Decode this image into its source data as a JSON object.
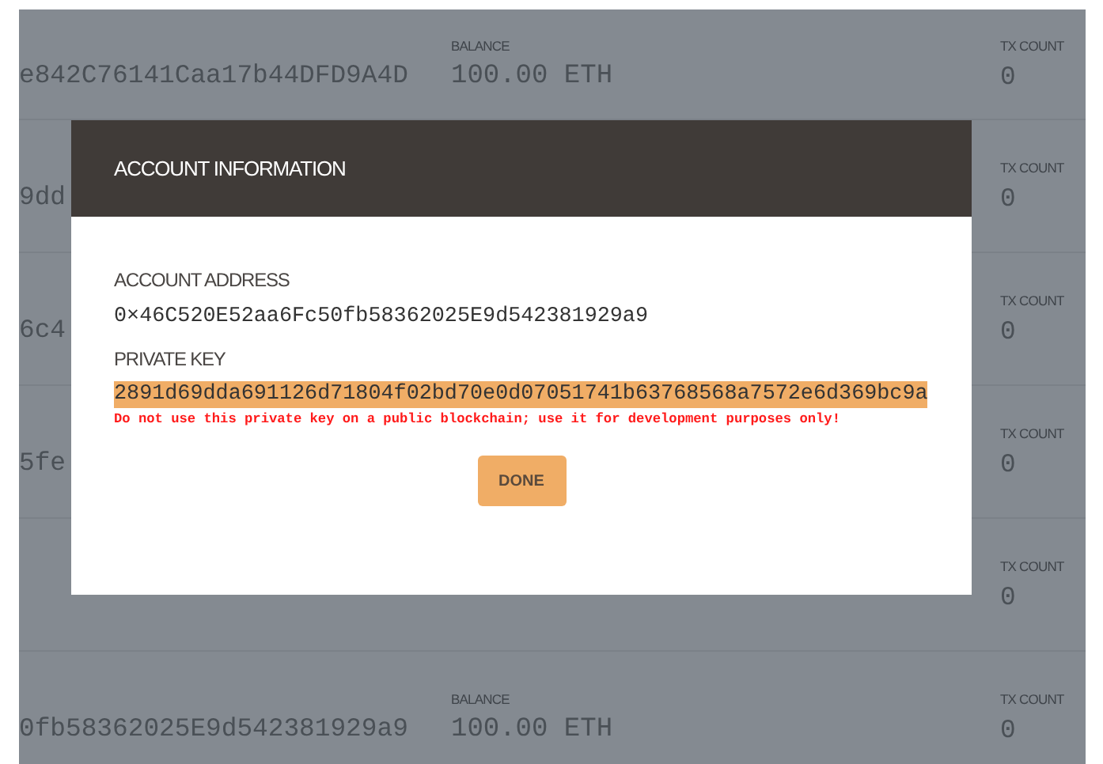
{
  "accounts": [
    {
      "address": "e842C76141Caa17b44DFD9A4D",
      "balance_label": "BALANCE",
      "balance": "100.00 ETH",
      "tx_label": "TX COUNT",
      "tx_count": "0"
    },
    {
      "address": "9dd",
      "tx_label": "TX COUNT",
      "tx_count": "0"
    },
    {
      "address": "6c4",
      "tx_label": "TX COUNT",
      "tx_count": "0"
    },
    {
      "address": "5fe",
      "tx_label": "TX COUNT",
      "tx_count": "0"
    },
    {
      "tx_label": "TX COUNT",
      "tx_count": "0"
    },
    {
      "address": "0fb58362025E9d542381929a9",
      "balance_label": "BALANCE",
      "balance": "100.00 ETH",
      "tx_label": "TX COUNT",
      "tx_count": "0"
    }
  ],
  "modal": {
    "title": "ACCOUNT INFORMATION",
    "fields": [
      {
        "kind": "address",
        "label": "ACCOUNT ADDRESS",
        "value": "0×46C520E52aa6Fc50fb58362025E9d542381929a9"
      },
      {
        "kind": "key",
        "label": "PRIVATE KEY",
        "value": "2891d69dda691126d71804f02bd70e0d07051741b63768568a7572e6d369bc9a"
      }
    ],
    "warning": "Do not use this private key on a public blockchain; use it for development purposes only!",
    "button": "DONE"
  }
}
